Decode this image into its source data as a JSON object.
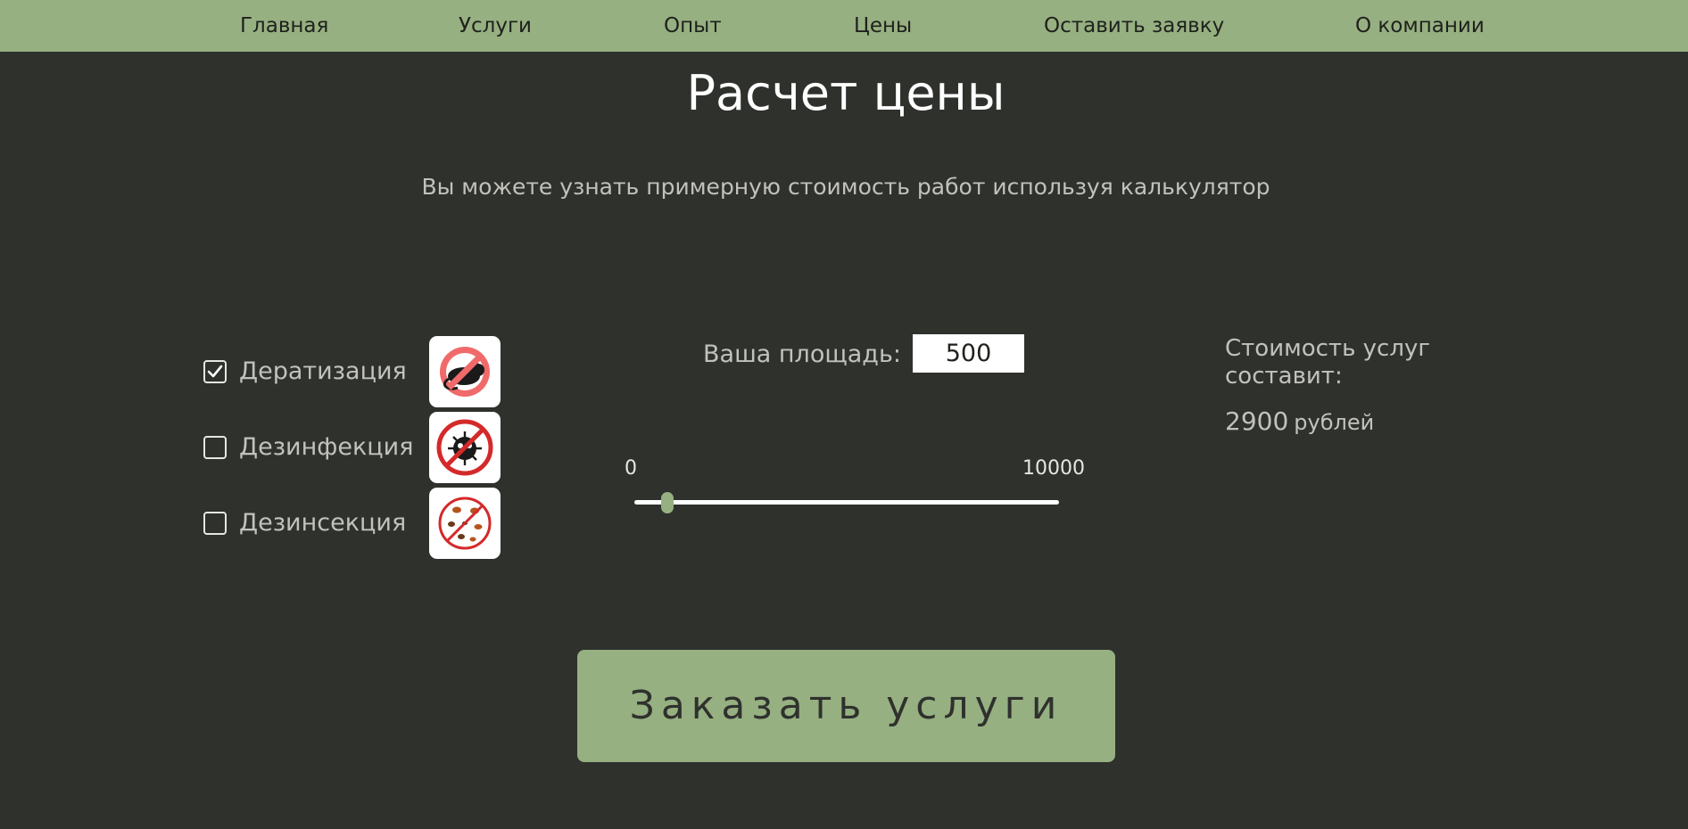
{
  "nav": {
    "items": [
      "Главная",
      "Услуги",
      "Опыт",
      "Цены",
      "Оставить заявку",
      "О компании"
    ]
  },
  "page_title": "Расчет цены",
  "subtitle": "Вы можете узнать примерную стоимость работ используя калькулятор",
  "services": [
    {
      "label": "Дератизация",
      "checked": true,
      "icon": "no-rats-icon"
    },
    {
      "label": "Дезинфекция",
      "checked": false,
      "icon": "no-germs-icon"
    },
    {
      "label": "Дезинсекция",
      "checked": false,
      "icon": "no-insects-icon"
    }
  ],
  "area": {
    "label": "Ваша площадь:",
    "value": "500",
    "min_label": "0",
    "max_label": "10000",
    "slider_value": 500,
    "slider_min": 0,
    "slider_max": 10000
  },
  "cost": {
    "label": "Стоимость услуг составит:",
    "value": "2900",
    "unit": "рублей"
  },
  "order_button": "Заказать услуги",
  "colors": {
    "background": "#2f312d",
    "accent": "#96b081",
    "text_muted": "#c2c2bc",
    "prohibit_red": "#e63b3b"
  }
}
